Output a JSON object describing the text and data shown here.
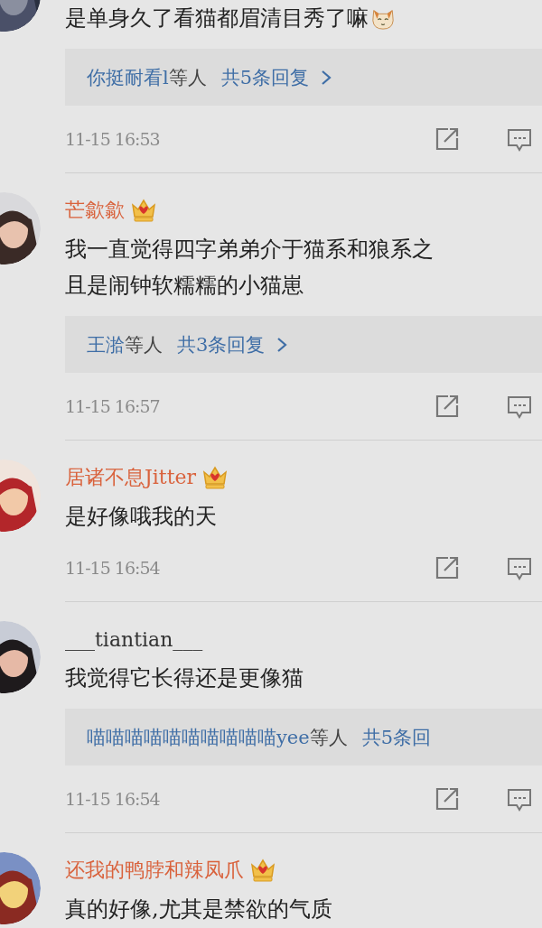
{
  "comments": [
    {
      "lines": [
        "是单身久了看猫都眉清目秀了嘛"
      ],
      "emoji": true,
      "replies": {
        "authors": "你挺耐看l",
        "suffix": "等人",
        "count": "共5条回复",
        "chevron": true
      },
      "time": "11-15 16:53"
    },
    {
      "name": "芒歙歙",
      "vip": true,
      "lines": [
        "我一直觉得四字弟弟介于猫系和狼系之",
        "且是闹钟软糯糯的小猫崽"
      ],
      "emoji": false,
      "replies": {
        "authors": "王湁",
        "suffix": "等人",
        "count": "共3条回复",
        "chevron": true
      },
      "time": "11-15 16:57"
    },
    {
      "name": "居诸不息Jitter",
      "vip": true,
      "lines": [
        "是好像哦我的天"
      ],
      "emoji": false,
      "time": "11-15 16:54"
    },
    {
      "name": "___tiantian___",
      "vip": false,
      "lines": [
        "我觉得它长得还是更像猫"
      ],
      "emoji": false,
      "replies": {
        "authors": "喵喵喵喵喵喵喵喵喵喵yee",
        "suffix": "等人",
        "count": "共5条回",
        "chevron": false
      },
      "time": "11-15 16:54"
    },
    {
      "name": "还我的鸭脖和辣凤爪",
      "vip": true,
      "lines": [
        "真的好像,尤其是禁欲的气质"
      ],
      "emoji": false
    }
  ]
}
